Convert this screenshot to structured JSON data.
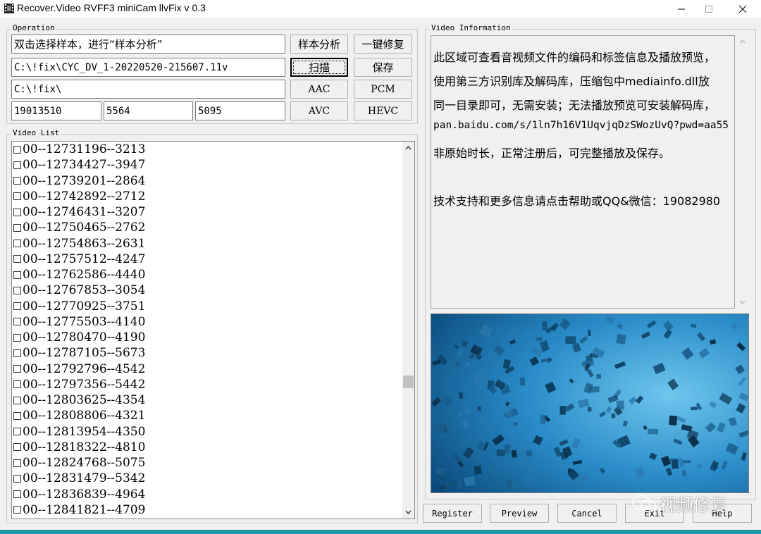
{
  "window": {
    "title": "Recover.Video RVFF3 miniCam llvFix v 0.3",
    "icon": "film-strip-icon"
  },
  "operation": {
    "legend": "Operation",
    "hint_field": "双击选择样本，进行“样本分析”",
    "path_field": "C:\\!fix\\CYC_DV_1-20220520-215607.11v",
    "dir_field": "C:\\!fix\\",
    "num1": "19013510",
    "num2": "5564",
    "num3": "5095",
    "buttons": {
      "analyze": "样本分析",
      "one_click_repair": "一键修复",
      "scan": "扫描",
      "save": "保存",
      "aac": "AAC",
      "pcm": "PCM",
      "avc": "AVC",
      "hevc": "HEVC"
    }
  },
  "video_list": {
    "legend": "Video List",
    "items": [
      "00--12731196--3213",
      "00--12734427--3947",
      "00--12739201--2864",
      "00--12742892--2712",
      "00--12746431--3207",
      "00--12750465--2762",
      "00--12754863--2631",
      "00--12757512--4247",
      "00--12762586--4440",
      "00--12767853--3054",
      "00--12770925--3751",
      "00--12775503--4140",
      "00--12780470--4190",
      "00--12787105--5673",
      "00--12792796--4542",
      "00--12797356--5442",
      "00--12803625--4354",
      "00--12808806--4321",
      "00--12813954--4350",
      "00--12818322--4810",
      "00--12824768--5075",
      "00--12831479--5342",
      "00--12836839--4964",
      "00--12841821--4709"
    ],
    "scroll_position": 0.65
  },
  "video_info": {
    "legend": "Video Information",
    "lines": [
      "此区域可查看音视频文件的编码和标签信息及播放预览，",
      "使用第三方识别库及解码库，压缩包中mediainfo.dll放",
      "同一目录即可，无需安装；无法播放预览可安装解码库，",
      "pan.baidu.com/s/1ln7h16V1UqvjqDzSWozUvQ?pwd=aa55",
      "非原始时长，正常注册后，可完整播放及保存。",
      "",
      "技术支持和更多信息请点击帮助或QQ&微信：19082980"
    ]
  },
  "bottom_buttons": {
    "register": "Register",
    "preview": "Preview",
    "cancel": "Cancel",
    "exit": "Exit",
    "help": "Help"
  },
  "watermark": "视频修复",
  "colors": {
    "accent_strip": "#1f9aa8",
    "preview_bg": "#2f8fc6"
  }
}
